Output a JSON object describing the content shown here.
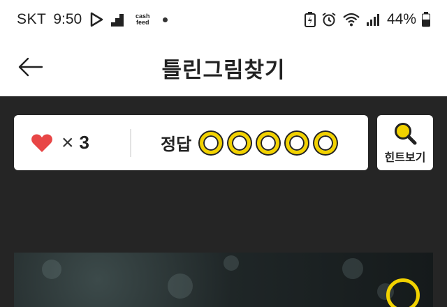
{
  "status_bar": {
    "carrier": "SKT",
    "time": "9:50",
    "notif_app_label_top": "cash",
    "notif_app_label_bottom": "feed",
    "battery_pct": "44%",
    "icons": [
      "play-icon",
      "pixel-app-icon",
      "cashfeed-icon",
      "dot-icon",
      "battery-saver-icon",
      "alarm-icon",
      "wifi-icon",
      "signal-icon",
      "battery-icon"
    ]
  },
  "header": {
    "title": "틀린그림찾기",
    "back_icon": "arrow-left-icon"
  },
  "stats": {
    "lives_icon": "heart-icon",
    "lives_multiplier": "×",
    "lives_count": "3",
    "answer_label": "정답",
    "answers_total": 5,
    "answers_found": 0
  },
  "hint": {
    "label": "힌트보기",
    "icon": "magnifier-icon"
  },
  "colors": {
    "background": "#252525",
    "accent_yellow": "#f2d200",
    "heart_red": "#e84646",
    "card": "#ffffff"
  }
}
